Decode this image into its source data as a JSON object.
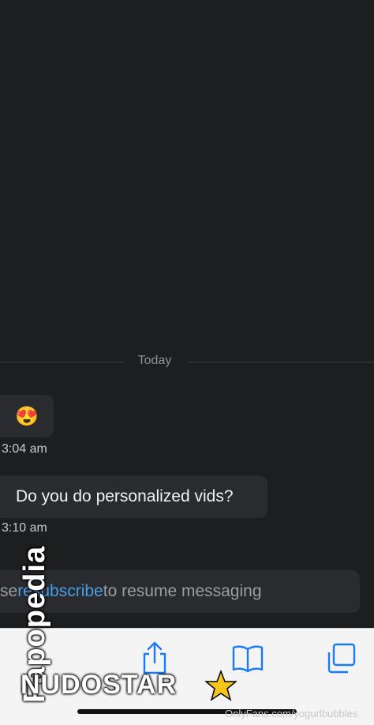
{
  "chat": {
    "date_divider": "Today",
    "messages": [
      {
        "content": "😍",
        "time": "3:04 am"
      },
      {
        "content": "Do you do personalized vids?",
        "time": "3:10 am"
      }
    ]
  },
  "composer": {
    "prefix": "se ",
    "link_text": "resubscribe",
    "suffix": " to resume messaging"
  },
  "toolbar": {
    "icons": [
      "share-icon",
      "bookmarks-icon",
      "tabs-icon"
    ],
    "accent": "#1a7cf4"
  },
  "watermarks": {
    "vertical": "Fapopedia",
    "bottom": "NUDOSTAR",
    "url": "OnlyFans.com/yogurlbubbles"
  }
}
